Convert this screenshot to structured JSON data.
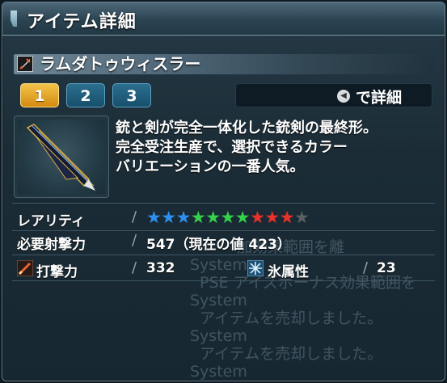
{
  "window": {
    "title": "アイテム詳細"
  },
  "item": {
    "name": "ラムダトゥウィスラー",
    "description": [
      "銃と剣が完全一体化した銃剣の最終形。",
      "完全受注生産で、選択できるカラー",
      "バリエーションの一番人気。"
    ]
  },
  "tabs": [
    {
      "label": "1",
      "active": true
    },
    {
      "label": "2",
      "active": false
    },
    {
      "label": "3",
      "active": false
    }
  ],
  "detail_button": {
    "key_icon": "controller-button-icon",
    "label": "で詳細"
  },
  "rarity": {
    "label": "レアリティ",
    "stars": 10,
    "max_stars": 11,
    "colors": [
      "#2f8ff0",
      "#2f8ff0",
      "#2f8ff0",
      "#35d14a",
      "#35d14a",
      "#35d14a",
      "#35d14a",
      "#e8322b",
      "#e8322b",
      "#e8322b",
      "#5a5f63"
    ]
  },
  "requirement": {
    "label": "必要射撃力",
    "value": "547（現在の値 423）"
  },
  "stats": {
    "attack": {
      "label": "打撃力",
      "value": "332",
      "icon": "strike-weapon-icon"
    },
    "element": {
      "label": "氷属性",
      "value": "23",
      "icon": "ice-element-icon"
    }
  },
  "chat_log": [
    "加効果範囲を離",
    "System",
    "PSE アイズボーナス効果範囲を",
    "System",
    "アイテムを売却しました。",
    "System",
    "アイテムを売却しました。",
    "System"
  ]
}
